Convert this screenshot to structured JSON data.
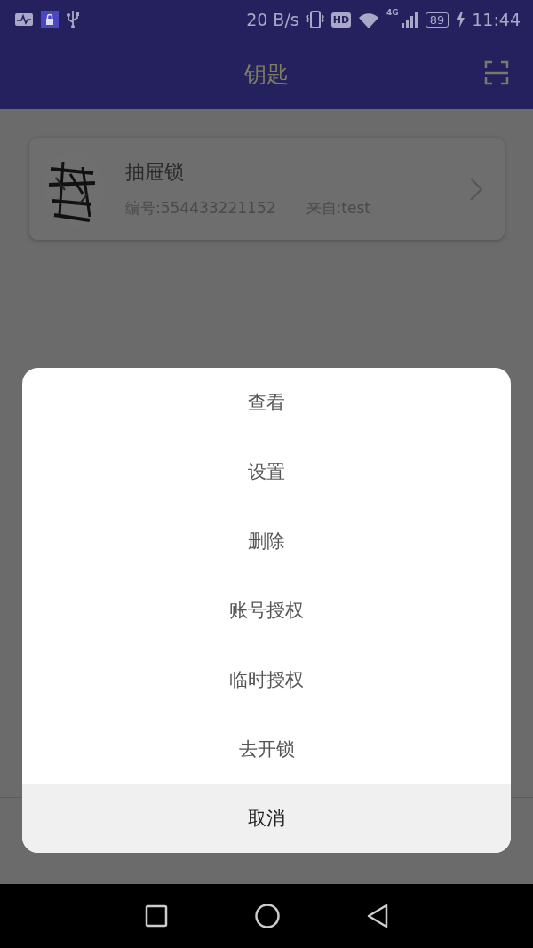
{
  "status_bar": {
    "speed": "20 B/s",
    "hd": "HD",
    "network": "4G",
    "battery": "89",
    "time": "11:44"
  },
  "header": {
    "title": "钥匙"
  },
  "keys": [
    {
      "name": "抽屉锁",
      "number": "编号:554433221152",
      "source": "来自:test"
    }
  ],
  "action_sheet": {
    "items": [
      "查看",
      "设置",
      "删除",
      "账号授权",
      "临时授权",
      "去开锁"
    ],
    "cancel": "取消"
  }
}
